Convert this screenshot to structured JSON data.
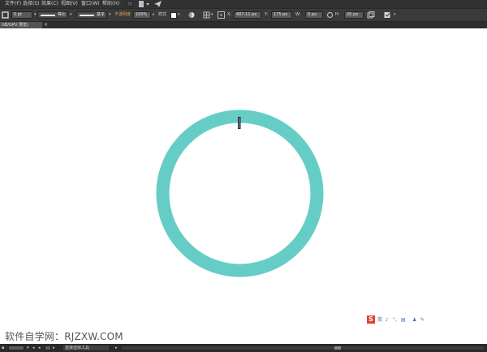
{
  "menubar": {
    "items": [
      "文件(F)",
      "选择(S)",
      "效果(C)",
      "视图(V)",
      "窗口(W)",
      "帮助(H)"
    ]
  },
  "controlbar": {
    "stroke_weight": "5 pt",
    "profile_label": "等比",
    "brush_label": "基本",
    "opacity_label": "不透明度",
    "opacity_value": "100%",
    "style_label": "样式",
    "x_value": "407.11 px",
    "y_value": "175 px",
    "w_value": "0 px",
    "h_value": "20 px"
  },
  "tabstrip": {
    "doc_tab": "GB/GPU 预览)",
    "close": "×"
  },
  "ime": {
    "logo": "S",
    "items": [
      "英",
      "♪",
      "°,",
      "▤",
      "♟",
      "✎"
    ]
  },
  "watermark": "软件自学网：RJZXW.COM",
  "statusbar": {
    "tool_name": "直接选择工具",
    "arrow_left": "◂",
    "arrow_right": "▸",
    "play": "▸"
  },
  "colors": {
    "ring": "#66cdc6",
    "ui_dark": "#323232",
    "accent": "#e0a050"
  }
}
